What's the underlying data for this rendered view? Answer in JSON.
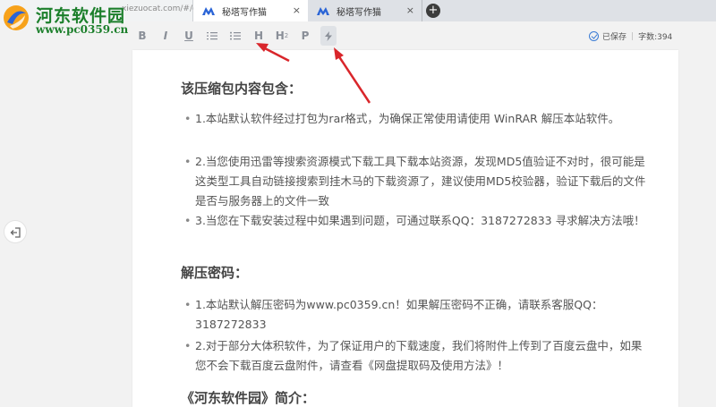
{
  "browser": {
    "address_text": "xiezuocat.com/#/ed",
    "tabs": [
      {
        "label": "秘塔写作猫",
        "close": "×",
        "active": true
      },
      {
        "label": "秘塔写作猫",
        "close": "×",
        "active": false
      }
    ],
    "new_tab": "+"
  },
  "watermark": {
    "title": "河东软件园",
    "url": "www.pc0359.cn"
  },
  "toolbar": {
    "bold": "B",
    "italic": "I",
    "underline": "U",
    "h_main": "H",
    "h_sub_main": "H",
    "h_sub_index": "2",
    "paragraph": "P",
    "saved_label": "已保存",
    "separator": "|",
    "word_count": "字数:394"
  },
  "doc": {
    "h1": "该压缩包内容包含：",
    "list1": [
      "1.本站默认软件经过打包为rar格式，为确保正常使用请使用 WinRAR 解压本站软件。",
      "2.当您使用迅雷等搜索资源模式下载工具下载本站资源，发现MD5值验证不对时，很可能是这类型工具自动链接搜索到挂木马的下载资源了，建议使用MD5校验器，验证下载后的文件是否与服务器上的文件一致",
      "3.当您在下载安装过程中如果遇到问题，可通过联系QQ：3187272833 寻求解决方法哦！"
    ],
    "h2": "解压密码：",
    "list2": [
      "1.本站默认解压密码为www.pc0359.cn！如果解压密码不正确，请联系客服QQ：3187272833",
      "2.对于部分大体积软件，为了保证用户的下载速度，我们将附件上传到了百度云盘中，如果您不会下载百度云盘附件，请查看《网盘提取码及使用方法》！"
    ],
    "h3": "《河东软件园》简介：",
    "bullet": "•"
  },
  "colors": {
    "watermark_green": "#1c7f2b",
    "arrow_red": "#d9262b",
    "saved_blue": "#3a7bd5"
  },
  "icons": {
    "exit": "exit-icon",
    "saved": "check-circle-icon",
    "bulleted_list": "bulleted-list-icon",
    "numbered_list": "numbered-list-icon",
    "format": "lightning-icon"
  }
}
